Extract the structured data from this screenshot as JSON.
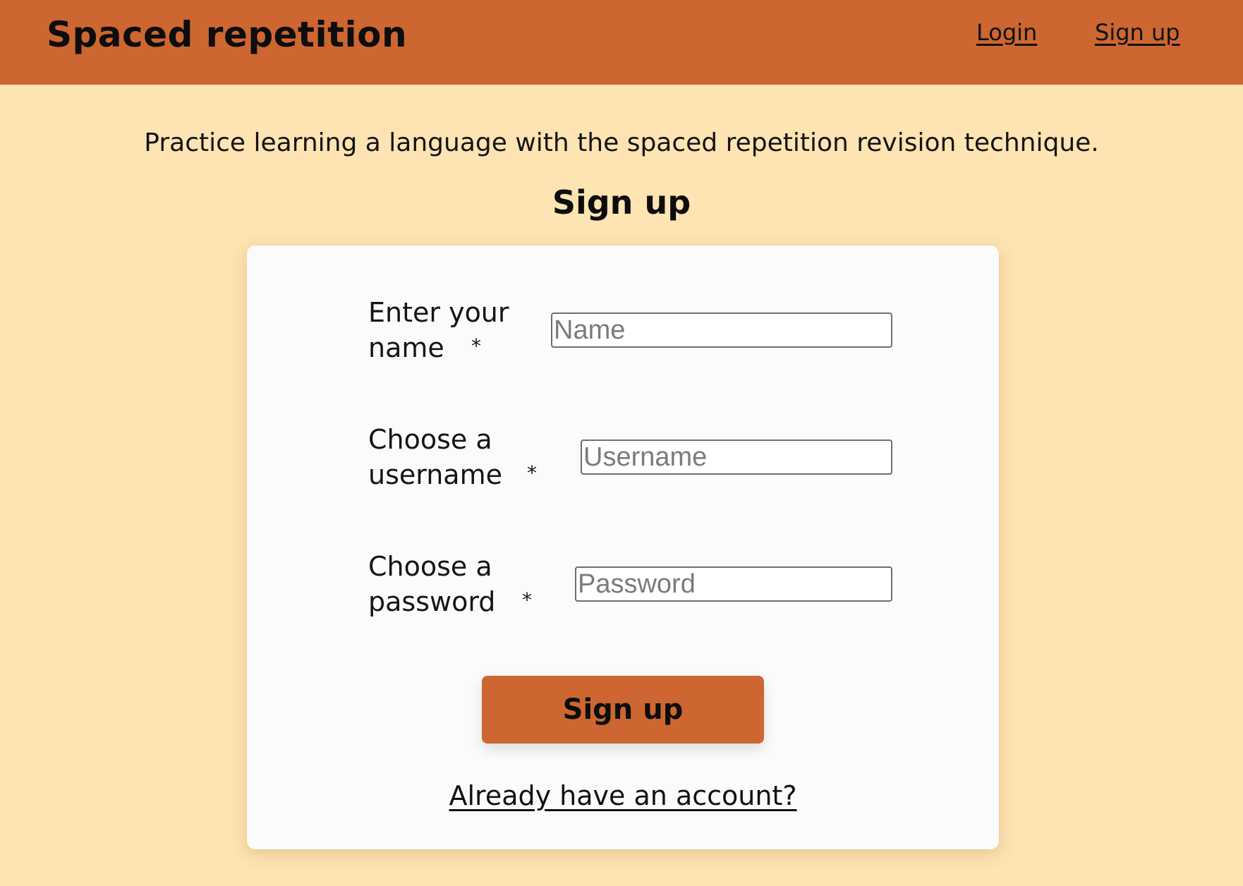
{
  "header": {
    "brand": "Spaced repetition",
    "nav": {
      "login": "Login",
      "signup": "Sign up"
    }
  },
  "intro": "Practice learning a language with the spaced repetition revision technique.",
  "form": {
    "title": "Sign up",
    "fields": {
      "name": {
        "label_line1": "Enter your",
        "label_line2": "name",
        "required_mark": "*",
        "placeholder": "Name",
        "value": ""
      },
      "username": {
        "label_line1": "Choose a",
        "label_line2": "username",
        "required_mark": "*",
        "placeholder": "Username",
        "value": ""
      },
      "password": {
        "label_line1": "Choose a",
        "label_line2": "password",
        "required_mark": "*",
        "placeholder": "Password",
        "value": ""
      }
    },
    "submit_label": "Sign up",
    "login_link": "Already have an account?"
  },
  "colors": {
    "header_bg": "#cd6631",
    "page_bg": "#fee4b3",
    "card_bg": "#fbfbfb",
    "button_bg": "#cd6631"
  }
}
